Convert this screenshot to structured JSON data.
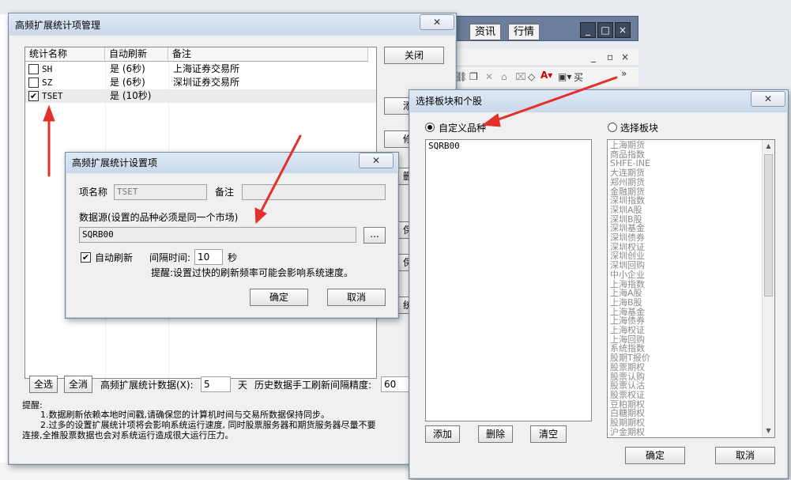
{
  "background": {
    "top_buttons": [
      "资讯",
      "行情"
    ],
    "window_controls": [
      "_",
      "□",
      "×"
    ],
    "mini_controls": [
      "_",
      "▫",
      "×"
    ],
    "toolbar_text": "买",
    "more_glyph": "»"
  },
  "main_window": {
    "title": "高频扩展统计项管理",
    "close_button": "关闭",
    "columns": [
      "统计名称",
      "自动刷新",
      "备注"
    ],
    "rows": [
      {
        "checked": false,
        "name": "SH",
        "auto": "是  (6秒)",
        "note": "上海证券交易所"
      },
      {
        "checked": false,
        "name": "SZ",
        "auto": "是  (6秒)",
        "note": "深圳证券交易所"
      },
      {
        "checked": true,
        "name": "TSET",
        "auto": "是  (10秒)",
        "note": ""
      }
    ],
    "select_all": "全选",
    "select_none": "全消",
    "days_label": "高频扩展统计数据(X):",
    "days_value": "5",
    "days_unit": "天",
    "history_label": "历史数据手工刷新间隔精度:",
    "history_value": "60",
    "notes_title": "提醒:",
    "notes": [
      "1.数据刷新依赖本地时间戳,请确保您的计算机时间与交易所数据保持同步。",
      "2.过多的设置扩展统计项将会影响系统运行速度, 同时股票服务器和期货服务器尽量不要",
      "连接,全推股票数据也会对系统运行造成很大运行压力。"
    ],
    "partial_buttons": [
      "添",
      "修",
      "删",
      "保",
      "保",
      "统"
    ]
  },
  "settings_dialog": {
    "title": "高频扩展统计设置项",
    "name_label": "项名称",
    "name_value": "TSET",
    "note_label": "备注",
    "note_value": "",
    "source_label": "数据源(设置的品种必须是同一个市场)",
    "source_value": "SQRB00",
    "browse_button": "...",
    "auto_refresh_label": "自动刷新",
    "auto_refresh_checked": true,
    "interval_label": "间隔时间:",
    "interval_value": "10",
    "interval_unit": "秒",
    "hint": "提醒:设置过快的刷新频率可能会影响系统速度。",
    "ok": "确定",
    "cancel": "取消"
  },
  "picker_dialog": {
    "title": "选择板块和个股",
    "custom_label": "自定义品种",
    "custom_selected": true,
    "custom_items": [
      "SQRB00"
    ],
    "block_label": "选择板块",
    "block_selected": false,
    "blocks": [
      "上海期货",
      "商品指数",
      "SHFE-INE",
      "大连期货",
      "郑州期货",
      "金融期货",
      "深圳指数",
      "深圳A股",
      "深圳B股",
      "深圳基金",
      "深圳债券",
      "深圳权证",
      "深圳创业",
      "深圳回购",
      "中小企业",
      "上海指数",
      "上海A股",
      "上海B股",
      "上海基金",
      "上海债券",
      "上海权证",
      "上海回购",
      "系统指数",
      "股期T报价",
      "股票期权",
      "股票认购",
      "股票认沽",
      "股票权证",
      "豆粕期权",
      "白糖期权",
      "股期期权",
      "沪金期权"
    ],
    "add": "添加",
    "delete": "删除",
    "clear": "清空",
    "ok": "确定",
    "cancel": "取消"
  }
}
